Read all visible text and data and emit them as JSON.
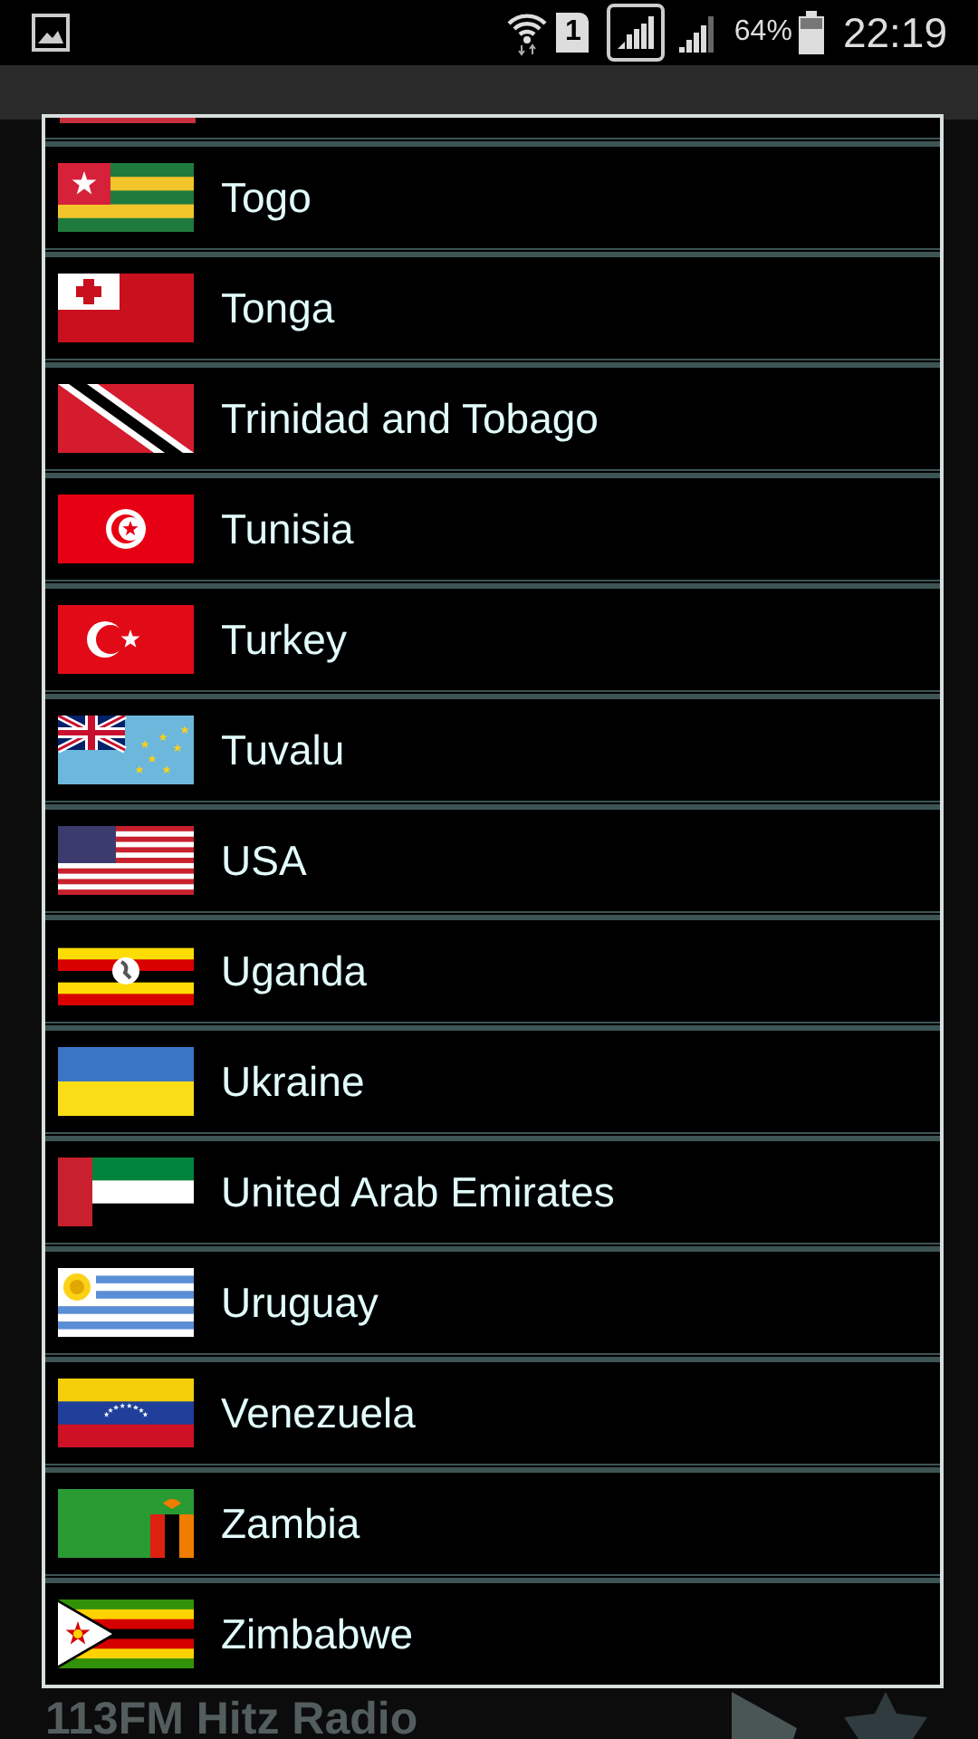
{
  "status_bar": {
    "sim_slot": "1",
    "battery": "64%",
    "time": "22:19"
  },
  "country_dialog": {
    "countries": [
      {
        "name": "Togo",
        "kind": "togo"
      },
      {
        "name": "Tonga",
        "kind": "tonga"
      },
      {
        "name": "Trinidad and Tobago",
        "kind": "trinidad"
      },
      {
        "name": "Tunisia",
        "kind": "tunisia"
      },
      {
        "name": "Turkey",
        "kind": "turkey"
      },
      {
        "name": "Tuvalu",
        "kind": "tuvalu"
      },
      {
        "name": "USA",
        "kind": "usa"
      },
      {
        "name": "Uganda",
        "kind": "uganda"
      },
      {
        "name": "Ukraine",
        "kind": "ukraine"
      },
      {
        "name": "United Arab Emirates",
        "kind": "uae"
      },
      {
        "name": "Uruguay",
        "kind": "uruguay"
      },
      {
        "name": "Venezuela",
        "kind": "venezuela"
      },
      {
        "name": "Zambia",
        "kind": "zambia"
      },
      {
        "name": "Zimbabwe",
        "kind": "zimbabwe"
      }
    ]
  },
  "now_playing": {
    "station": "113FM Hitz Radio"
  }
}
